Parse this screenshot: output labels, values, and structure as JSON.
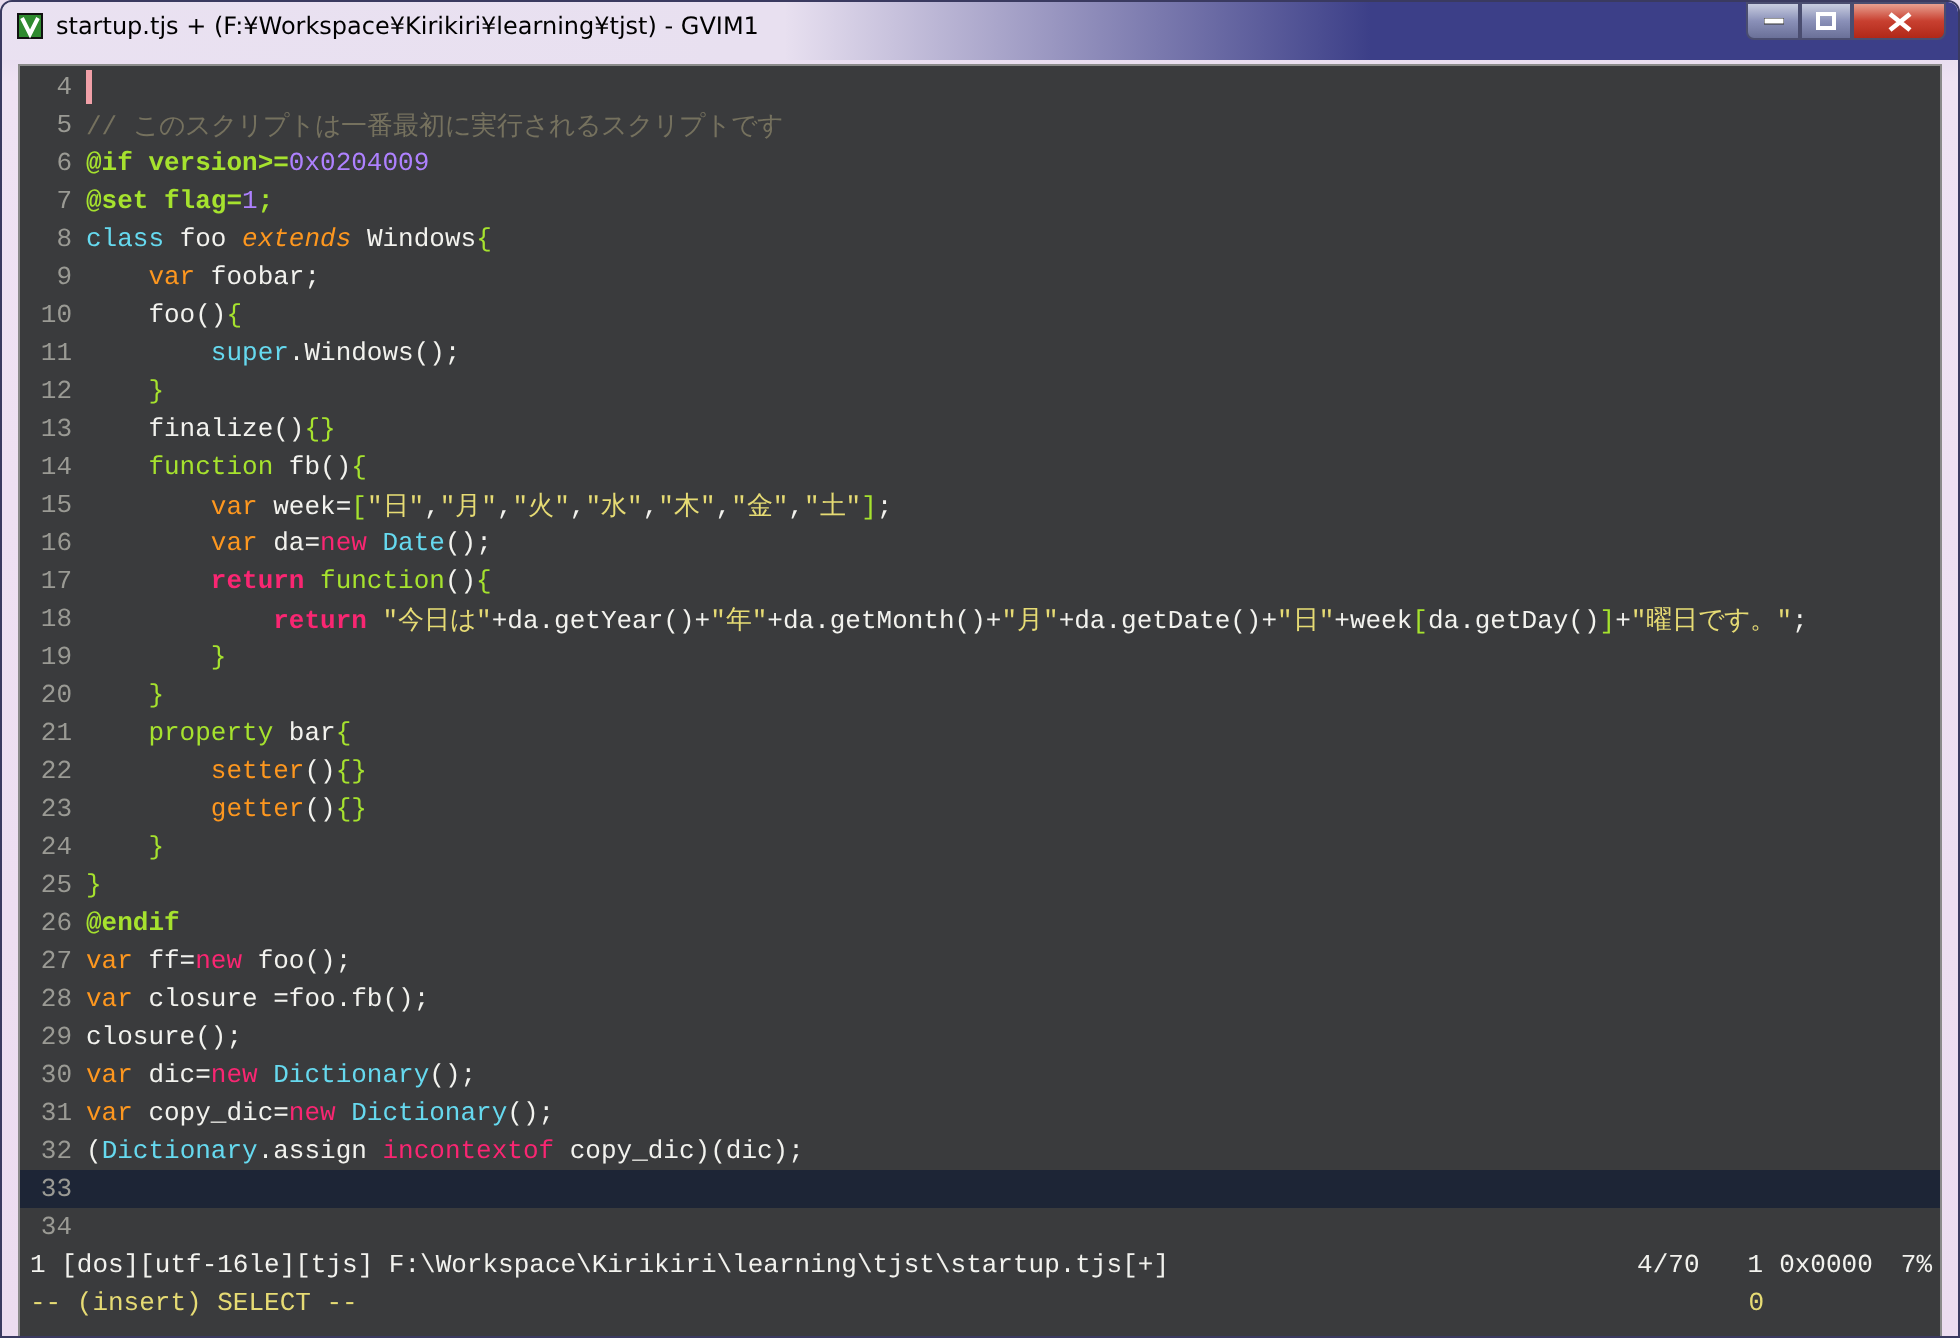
{
  "window": {
    "title": "startup.tjs + (F:¥Workspace¥Kirikiri¥learning¥tjst) - GVIM1"
  },
  "editor": {
    "lines": [
      {
        "number": "4",
        "cursor": true,
        "highlighted": false
      },
      {
        "number": "5",
        "cursor": false,
        "highlighted": false,
        "tokens": [
          {
            "kind": "comment",
            "text": "// このスクリプトは一番最初に実行されるスクリプトです"
          }
        ]
      },
      {
        "number": "6",
        "cursor": false,
        "highlighted": false,
        "tokens": [
          {
            "kind": "preproc",
            "text": "@if version>="
          },
          {
            "kind": "number",
            "text": "0x0204009"
          }
        ]
      },
      {
        "number": "7",
        "cursor": false,
        "highlighted": false,
        "tokens": [
          {
            "kind": "preproc",
            "text": "@set flag="
          },
          {
            "kind": "number",
            "text": "1"
          },
          {
            "kind": "preproc",
            "text": ";"
          }
        ]
      },
      {
        "number": "8",
        "cursor": false,
        "highlighted": false,
        "tokens": [
          {
            "kind": "keyword",
            "text": "class"
          },
          {
            "kind": "plain",
            "text": " foo "
          },
          {
            "kind": "modifier",
            "text": "extends"
          },
          {
            "kind": "plain",
            "text": " Windows"
          },
          {
            "kind": "bracket",
            "text": "{"
          }
        ]
      },
      {
        "number": "9",
        "cursor": false,
        "highlighted": false,
        "tokens": [
          {
            "kind": "storage",
            "text": "    var"
          },
          {
            "kind": "plain",
            "text": " foobar;"
          }
        ]
      },
      {
        "number": "10",
        "cursor": false,
        "highlighted": false,
        "tokens": [
          {
            "kind": "plain",
            "text": "    foo()"
          },
          {
            "kind": "bracket",
            "text": "{"
          }
        ]
      },
      {
        "number": "11",
        "cursor": false,
        "highlighted": false,
        "tokens": [
          {
            "kind": "keyword",
            "text": "        super"
          },
          {
            "kind": "plain",
            "text": ".Windows();"
          }
        ]
      },
      {
        "number": "12",
        "cursor": false,
        "highlighted": false,
        "tokens": [
          {
            "kind": "bracket",
            "text": "    }"
          }
        ]
      },
      {
        "number": "13",
        "cursor": false,
        "highlighted": false,
        "tokens": [
          {
            "kind": "plain",
            "text": "    finalize()"
          },
          {
            "kind": "bracket",
            "text": "{}"
          }
        ]
      },
      {
        "number": "14",
        "cursor": false,
        "highlighted": false,
        "tokens": [
          {
            "kind": "function",
            "text": "    function"
          },
          {
            "kind": "plain",
            "text": " fb()"
          },
          {
            "kind": "bracket",
            "text": "{"
          }
        ]
      },
      {
        "number": "15",
        "cursor": false,
        "highlighted": false,
        "tokens": [
          {
            "kind": "storage",
            "text": "        var"
          },
          {
            "kind": "plain",
            "text": " week="
          },
          {
            "kind": "bracket",
            "text": "["
          },
          {
            "kind": "string",
            "text": "\"日\""
          },
          {
            "kind": "plain",
            "text": ","
          },
          {
            "kind": "string",
            "text": "\"月\""
          },
          {
            "kind": "plain",
            "text": ","
          },
          {
            "kind": "string",
            "text": "\"火\""
          },
          {
            "kind": "plain",
            "text": ","
          },
          {
            "kind": "string",
            "text": "\"水\""
          },
          {
            "kind": "plain",
            "text": ","
          },
          {
            "kind": "string",
            "text": "\"木\""
          },
          {
            "kind": "plain",
            "text": ","
          },
          {
            "kind": "string",
            "text": "\"金\""
          },
          {
            "kind": "plain",
            "text": ","
          },
          {
            "kind": "string",
            "text": "\"土\""
          },
          {
            "kind": "bracket",
            "text": "]"
          },
          {
            "kind": "plain",
            "text": ";"
          }
        ]
      },
      {
        "number": "16",
        "cursor": false,
        "highlighted": false,
        "tokens": [
          {
            "kind": "storage",
            "text": "        var"
          },
          {
            "kind": "plain",
            "text": " da="
          },
          {
            "kind": "operator",
            "text": "new"
          },
          {
            "kind": "keyword",
            "text": " Date"
          },
          {
            "kind": "plain",
            "text": "();"
          }
        ]
      },
      {
        "number": "17",
        "cursor": false,
        "highlighted": false,
        "tokens": [
          {
            "kind": "control",
            "text": "        return"
          },
          {
            "kind": "function",
            "text": " function"
          },
          {
            "kind": "plain",
            "text": "()"
          },
          {
            "kind": "bracket",
            "text": "{"
          }
        ]
      },
      {
        "number": "18",
        "cursor": false,
        "highlighted": false,
        "tokens": [
          {
            "kind": "control",
            "text": "            return"
          },
          {
            "kind": "string",
            "text": " \"今日は\""
          },
          {
            "kind": "plain",
            "text": "+da.getYear()+"
          },
          {
            "kind": "string",
            "text": "\"年\""
          },
          {
            "kind": "plain",
            "text": "+da.getMonth()+"
          },
          {
            "kind": "string",
            "text": "\"月\""
          },
          {
            "kind": "plain",
            "text": "+da.getDate()+"
          },
          {
            "kind": "string",
            "text": "\"日\""
          },
          {
            "kind": "plain",
            "text": "+week"
          },
          {
            "kind": "bracket",
            "text": "["
          },
          {
            "kind": "plain",
            "text": "da.getDay()"
          },
          {
            "kind": "bracket",
            "text": "]"
          },
          {
            "kind": "plain",
            "text": "+"
          },
          {
            "kind": "string",
            "text": "\"曜日です。\""
          },
          {
            "kind": "plain",
            "text": ";"
          }
        ]
      },
      {
        "number": "19",
        "cursor": false,
        "highlighted": false,
        "tokens": [
          {
            "kind": "bracket",
            "text": "        }"
          }
        ]
      },
      {
        "number": "20",
        "cursor": false,
        "highlighted": false,
        "tokens": [
          {
            "kind": "bracket",
            "text": "    }"
          }
        ]
      },
      {
        "number": "21",
        "cursor": false,
        "highlighted": false,
        "tokens": [
          {
            "kind": "function",
            "text": "    property"
          },
          {
            "kind": "plain",
            "text": " bar"
          },
          {
            "kind": "bracket",
            "text": "{"
          }
        ]
      },
      {
        "number": "22",
        "cursor": false,
        "highlighted": false,
        "tokens": [
          {
            "kind": "method",
            "text": "        setter"
          },
          {
            "kind": "plain",
            "text": "()"
          },
          {
            "kind": "bracket",
            "text": "{}"
          }
        ]
      },
      {
        "number": "23",
        "cursor": false,
        "highlighted": false,
        "tokens": [
          {
            "kind": "method",
            "text": "        getter"
          },
          {
            "kind": "plain",
            "text": "()"
          },
          {
            "kind": "bracket",
            "text": "{}"
          }
        ]
      },
      {
        "number": "24",
        "cursor": false,
        "highlighted": false,
        "tokens": [
          {
            "kind": "bracket",
            "text": "    }"
          }
        ]
      },
      {
        "number": "25",
        "cursor": false,
        "highlighted": false,
        "tokens": [
          {
            "kind": "bracket",
            "text": "}"
          }
        ]
      },
      {
        "number": "26",
        "cursor": false,
        "highlighted": false,
        "tokens": [
          {
            "kind": "preproc",
            "text": "@endif"
          }
        ]
      },
      {
        "number": "27",
        "cursor": false,
        "highlighted": false,
        "tokens": [
          {
            "kind": "storage",
            "text": "var"
          },
          {
            "kind": "plain",
            "text": " ff="
          },
          {
            "kind": "operator",
            "text": "new"
          },
          {
            "kind": "plain",
            "text": " foo();"
          }
        ]
      },
      {
        "number": "28",
        "cursor": false,
        "highlighted": false,
        "tokens": [
          {
            "kind": "storage",
            "text": "var"
          },
          {
            "kind": "plain",
            "text": " closure =foo.fb();"
          }
        ]
      },
      {
        "number": "29",
        "cursor": false,
        "highlighted": false,
        "tokens": [
          {
            "kind": "plain",
            "text": "closure();"
          }
        ]
      },
      {
        "number": "30",
        "cursor": false,
        "highlighted": false,
        "tokens": [
          {
            "kind": "storage",
            "text": "var"
          },
          {
            "kind": "plain",
            "text": " dic="
          },
          {
            "kind": "operator",
            "text": "new"
          },
          {
            "kind": "keyword",
            "text": " Dictionary"
          },
          {
            "kind": "plain",
            "text": "();"
          }
        ]
      },
      {
        "number": "31",
        "cursor": false,
        "highlighted": false,
        "tokens": [
          {
            "kind": "storage",
            "text": "var"
          },
          {
            "kind": "plain",
            "text": " copy_dic="
          },
          {
            "kind": "operator",
            "text": "new"
          },
          {
            "kind": "keyword",
            "text": " Dictionary"
          },
          {
            "kind": "plain",
            "text": "();"
          }
        ]
      },
      {
        "number": "32",
        "cursor": false,
        "highlighted": false,
        "tokens": [
          {
            "kind": "plain",
            "text": "("
          },
          {
            "kind": "keyword",
            "text": "Dictionary"
          },
          {
            "kind": "plain",
            "text": ".assign "
          },
          {
            "kind": "operator",
            "text": "incontextof"
          },
          {
            "kind": "plain",
            "text": " copy_dic)(dic);"
          }
        ]
      },
      {
        "number": "33",
        "cursor": false,
        "highlighted": true
      },
      {
        "number": "34",
        "cursor": false,
        "highlighted": false
      }
    ]
  },
  "status_line": {
    "file": "1 [dos][utf-16le][tjs] F:\\Workspace\\Kirikiri\\learning\\tjst\\startup.tjs[+]",
    "position": "4/70",
    "column": "1",
    "char_code": "0x0000",
    "percent": "7%"
  },
  "command_line": {
    "mode": "-- (insert) SELECT --",
    "count": "0"
  }
}
